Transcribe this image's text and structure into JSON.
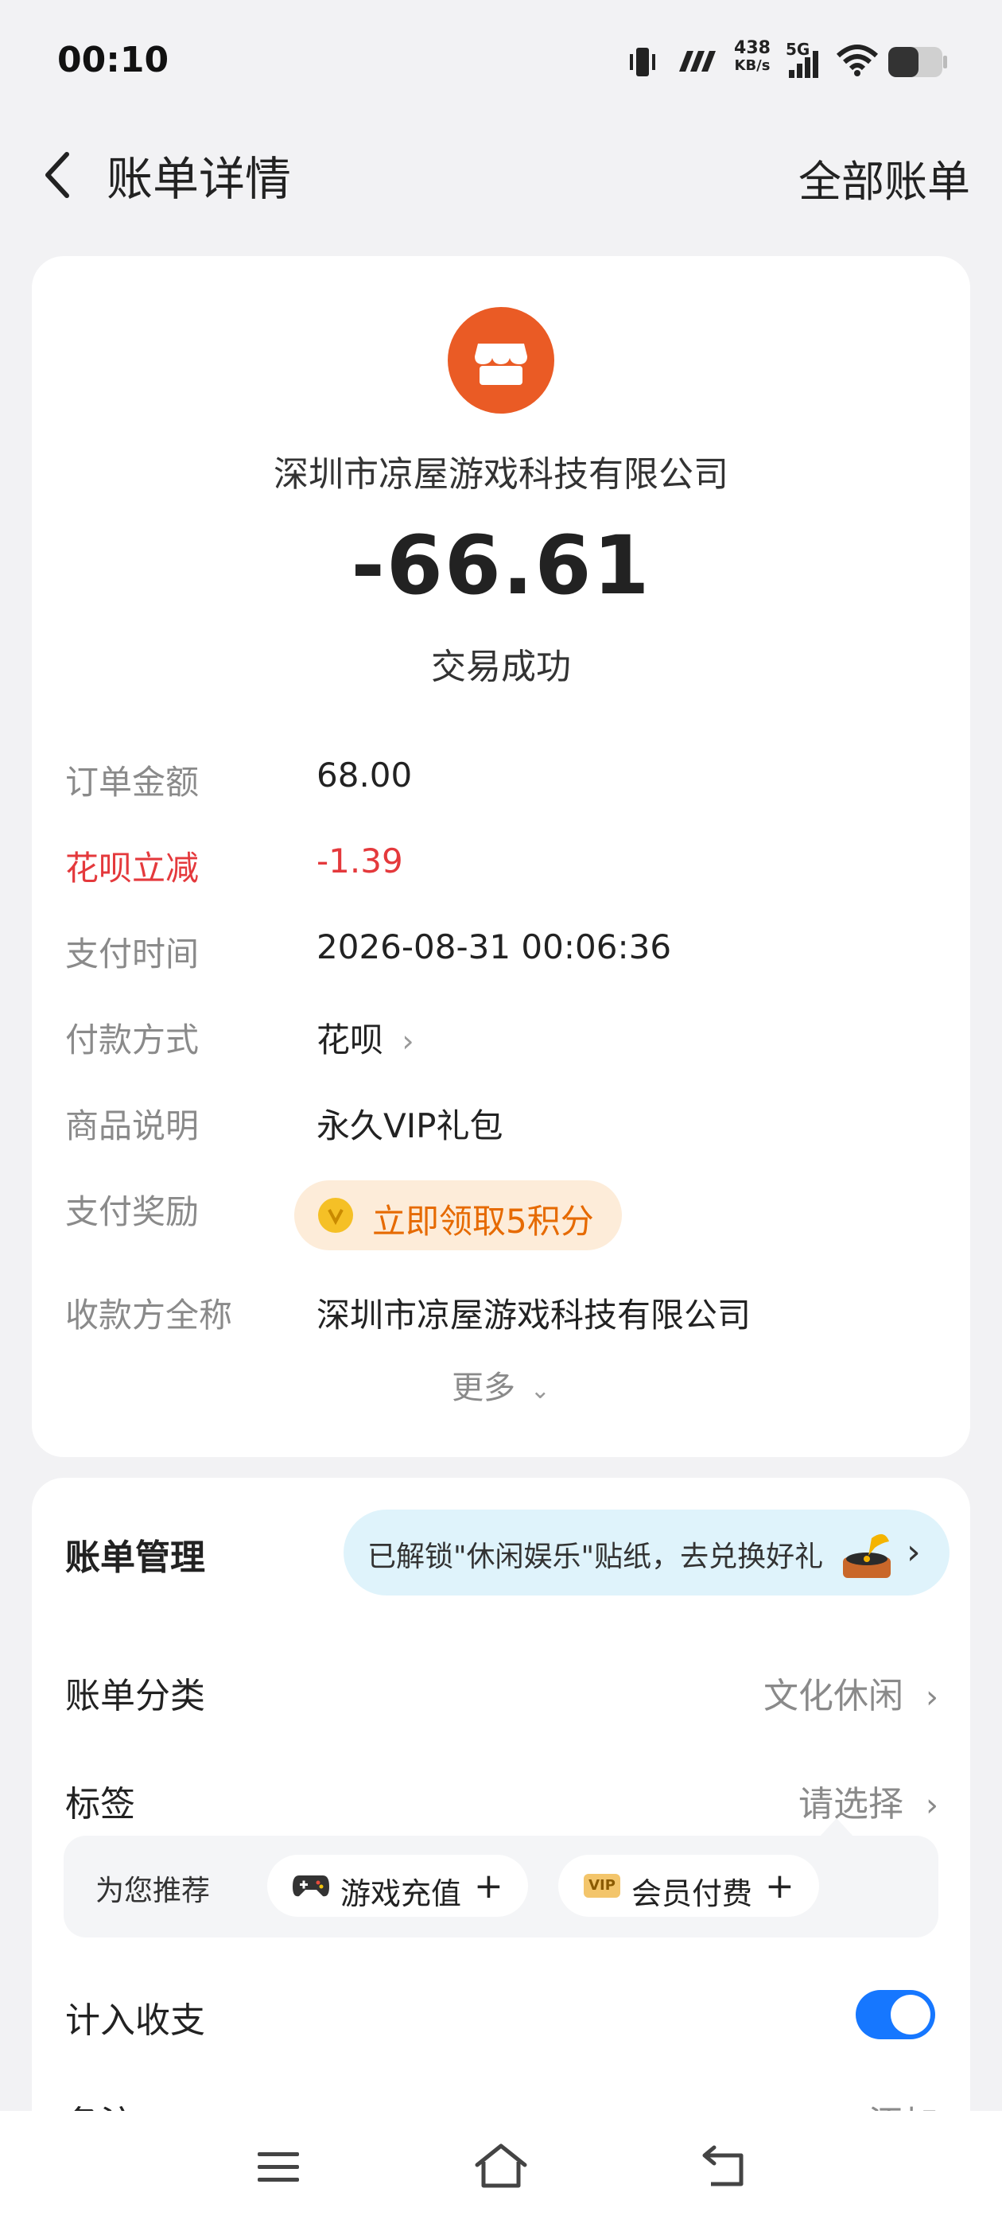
{
  "status_bar": {
    "time": "00:10",
    "net_speed_value": "438",
    "net_speed_unit": "KB/s",
    "network": "5G",
    "icons": [
      "vibrate-icon",
      "carrier-icon",
      "signal-icon",
      "wifi-icon",
      "battery-icon"
    ]
  },
  "header": {
    "title": "账单详情",
    "all_bills": "全部账单"
  },
  "transaction": {
    "merchant": "深圳市凉屋游戏科技有限公司",
    "amount": "-66.61",
    "status": "交易成功",
    "details": {
      "order_amount_label": "订单金额",
      "order_amount_value": "68.00",
      "discount_label": "花呗立减",
      "discount_value": "-1.39",
      "pay_time_label": "支付时间",
      "pay_time_value": "2026-08-31 00:06:36",
      "pay_method_label": "付款方式",
      "pay_method_value": "花呗",
      "product_label": "商品说明",
      "product_value": "永久VIP礼包",
      "reward_label": "支付奖励",
      "reward_value": "立即领取5积分",
      "payee_label": "收款方全称",
      "payee_value": "深圳市凉屋游戏科技有限公司"
    },
    "more": "更多"
  },
  "bill_management": {
    "title": "账单管理",
    "promo_text": "已解锁\"休闲娱乐\"贴纸，去兑换好礼",
    "category_label": "账单分类",
    "category_value": "文化休闲",
    "tag_label": "标签",
    "tag_value": "请选择",
    "recommend_label": "为您推荐",
    "recommend_chips": [
      "游戏充值",
      "会员付费"
    ],
    "vip_badge": "VIP",
    "include_label": "计入收支",
    "include_on": true,
    "note_label": "备注",
    "note_value": "添加"
  },
  "colors": {
    "accent_blue": "#1677ff",
    "merchant_orange": "#ea5b25",
    "discount_red": "#e4393c",
    "reward_orange": "#e66a00"
  }
}
